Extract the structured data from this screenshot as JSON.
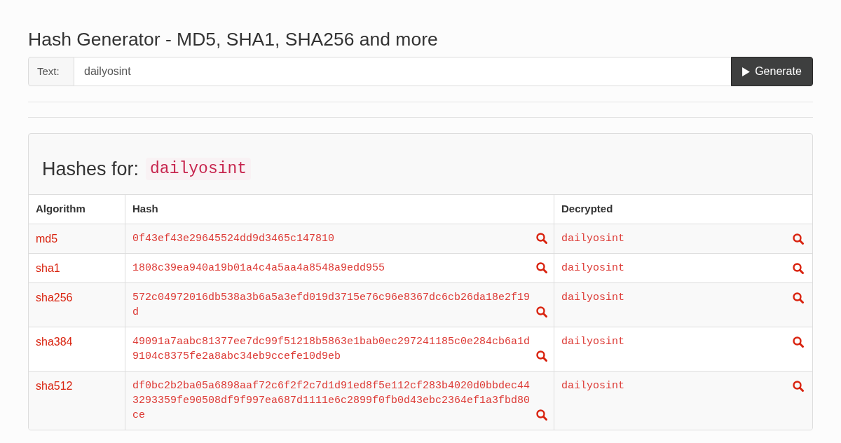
{
  "page": {
    "title": "Hash Generator - MD5, SHA1, SHA256 and more"
  },
  "form": {
    "label": "Text:",
    "value": "dailyosint",
    "button": "Generate"
  },
  "results": {
    "heading": "Hashes for:",
    "query": "dailyosint",
    "table": {
      "columns": [
        "Algorithm",
        "Hash",
        "Decrypted"
      ],
      "rows": [
        {
          "algorithm": "md5",
          "hash": "0f43ef43e29645524dd9d3465c147810",
          "decrypted": "dailyosint"
        },
        {
          "algorithm": "sha1",
          "hash": "1808c39ea940a19b01a4c4a5aa4a8548a9edd955",
          "decrypted": "dailyosint"
        },
        {
          "algorithm": "sha256",
          "hash": "572c04972016db538a3b6a5a3efd019d3715e76c96e8367dc6cb26da18e2f19d",
          "decrypted": "dailyosint"
        },
        {
          "algorithm": "sha384",
          "hash": "49091a7aabc81377ee7dc99f51218b5863e1bab0ec297241185c0e284cb6a1d9104c8375fe2a8abc34eb9ccefe10d9eb",
          "decrypted": "dailyosint"
        },
        {
          "algorithm": "sha512",
          "hash": "df0bc2b2ba05a6898aaf72c6f2f2c7d1d91ed8f5e112cf283b4020d0bbdec443293359fe90508df9f997ea687d1111e6c2899f0fb0d43ebc2364ef1a3fbd80ce",
          "decrypted": "dailyosint"
        }
      ]
    }
  }
}
